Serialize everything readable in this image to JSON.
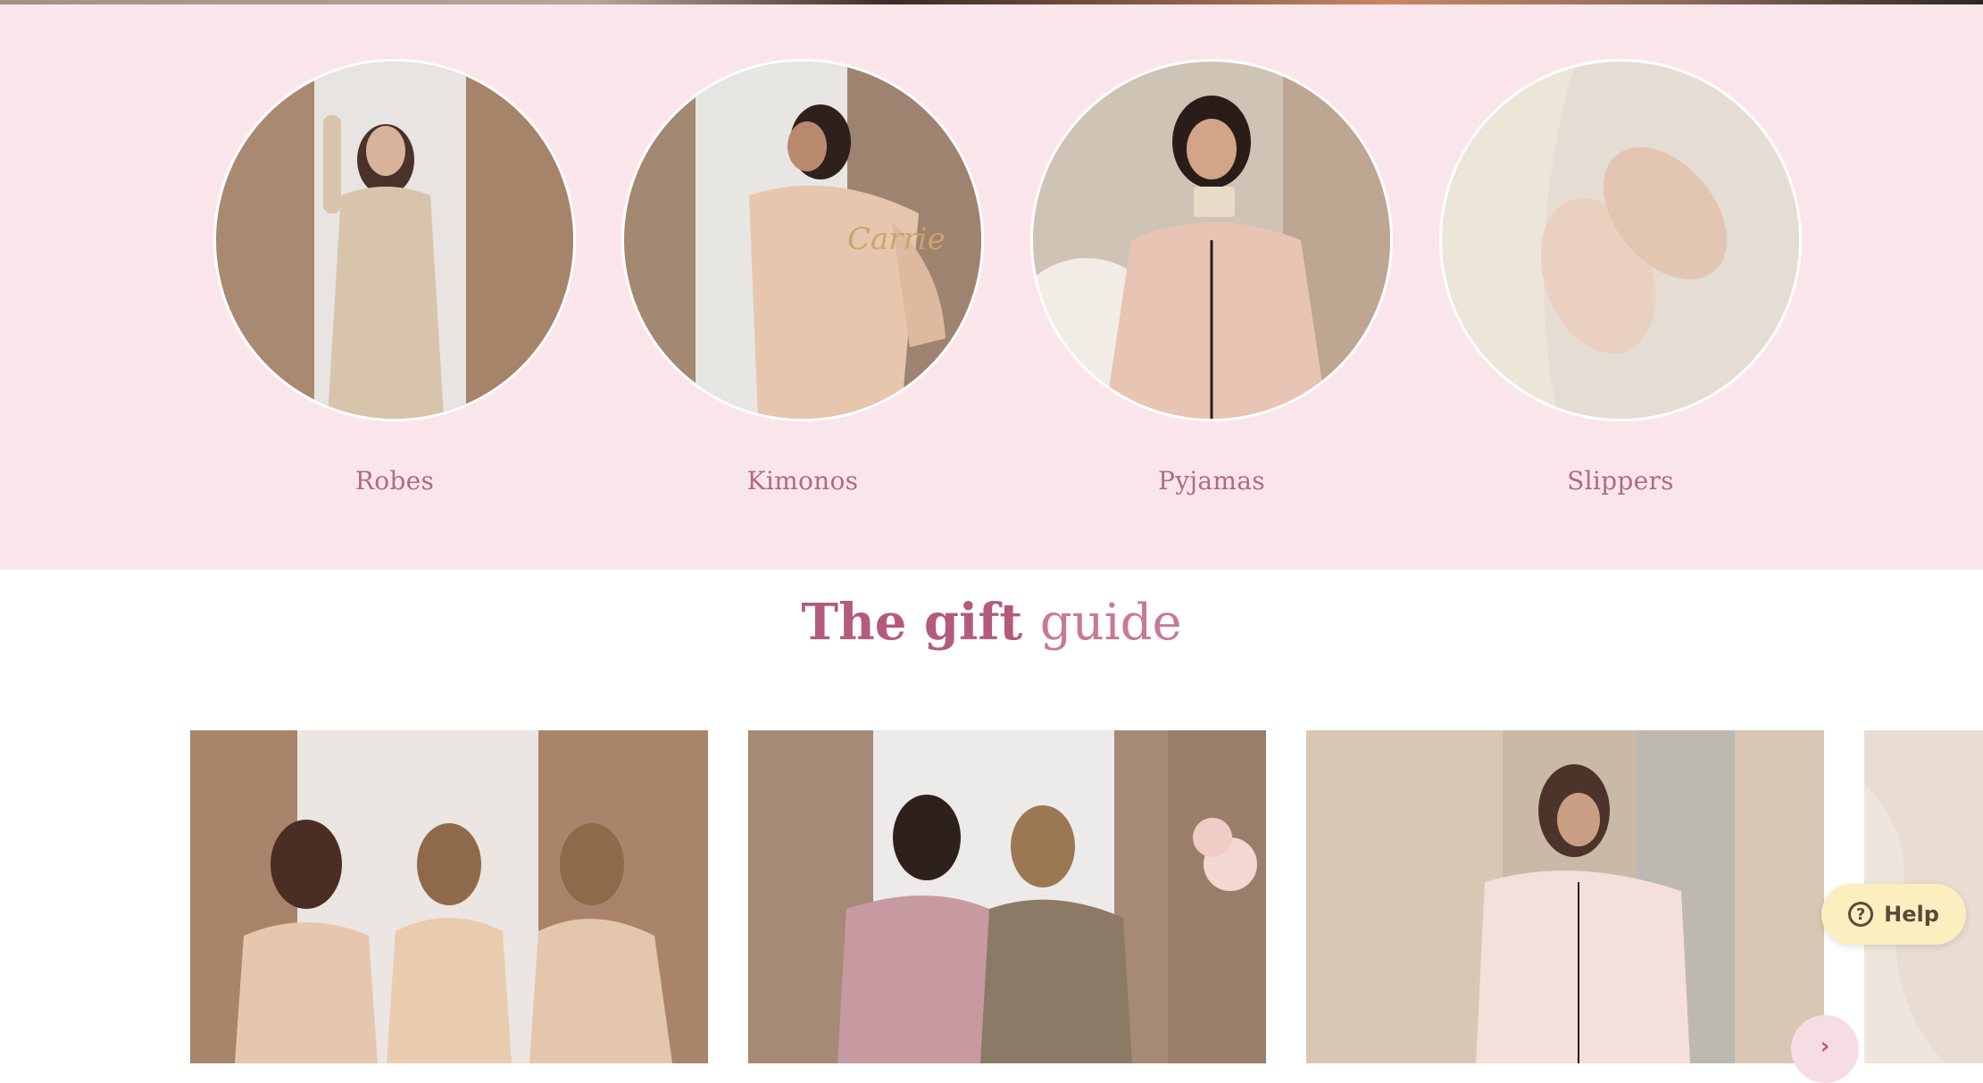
{
  "categories": [
    {
      "label": "Robes"
    },
    {
      "label": "Kimonos"
    },
    {
      "label": "Pyjamas"
    },
    {
      "label": "Slippers"
    }
  ],
  "gift_guide": {
    "title_part1": "The gift",
    "title_part2": "guide"
  },
  "help_button": {
    "label": "Help",
    "icon": "question-circle-icon"
  },
  "carousel": {
    "next_icon": "chevron-right-icon"
  },
  "colors": {
    "band_background": "#fae6ea",
    "accent": "#b35b7d",
    "help_background": "#fbefc0"
  }
}
